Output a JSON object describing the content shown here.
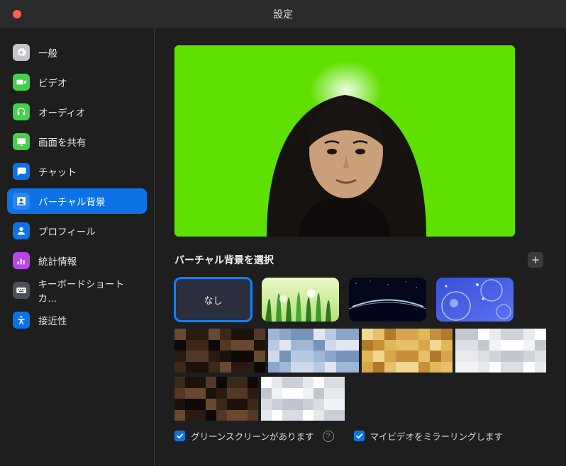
{
  "window": {
    "title": "設定"
  },
  "sidebar": {
    "items": [
      {
        "label": "一般",
        "icon": "gear",
        "color": "#c2c4c7"
      },
      {
        "label": "ビデオ",
        "icon": "video",
        "color": "#43d14a"
      },
      {
        "label": "オーディオ",
        "icon": "audio",
        "color": "#43d14a"
      },
      {
        "label": "画面を共有",
        "icon": "share",
        "color": "#43d14a"
      },
      {
        "label": "チャット",
        "icon": "chat",
        "color": "#0e72e7"
      },
      {
        "label": "バーチャル背景",
        "icon": "portrait",
        "color": "#0e72e7",
        "selected": true
      },
      {
        "label": "プロフィール",
        "icon": "user",
        "color": "#0e72e7"
      },
      {
        "label": "統計情報",
        "icon": "stats",
        "color": "#b745e8"
      },
      {
        "label": "キーボードショートカ…",
        "icon": "keyboard",
        "color": "#4b4f58"
      },
      {
        "label": "接近性",
        "icon": "access",
        "color": "#0e72e7"
      }
    ]
  },
  "main": {
    "section_title": "バーチャル背景を選択",
    "none_label": "なし",
    "backgrounds": [
      {
        "kind": "none",
        "selected": true
      },
      {
        "kind": "grass"
      },
      {
        "kind": "earth"
      },
      {
        "kind": "bubbles"
      }
    ],
    "checkbox_green_screen": "グリーンスクリーンがあります",
    "checkbox_mirror": "マイビデオをミラーリングします",
    "green_screen_checked": true,
    "mirror_checked": true
  }
}
